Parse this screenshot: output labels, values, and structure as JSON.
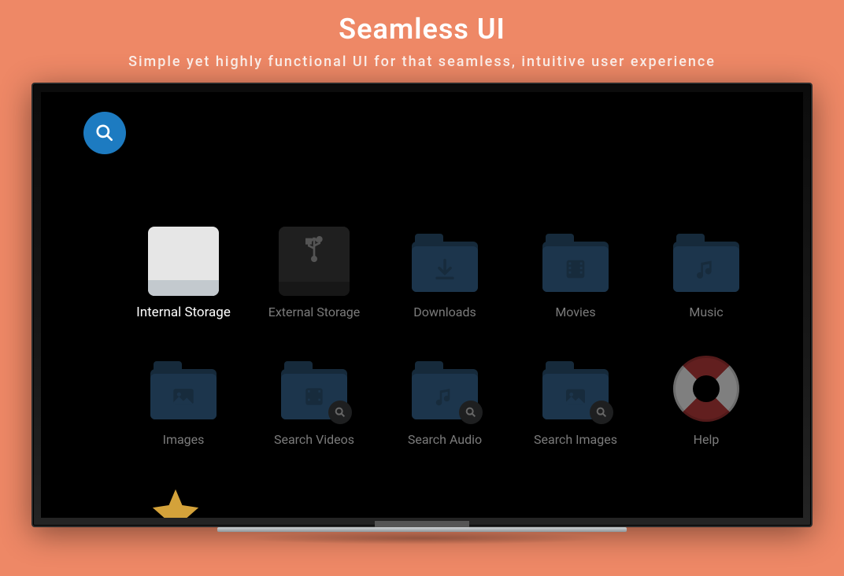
{
  "hero": {
    "title": "Seamless UI",
    "subtitle": "Simple yet highly functional UI for that seamless, intuitive user experience"
  },
  "screen": {
    "search_button": "Search",
    "tiles": [
      {
        "label": "Internal Storage",
        "icon": "drive-icon",
        "active": true
      },
      {
        "label": "External Storage",
        "icon": "usb-drive-icon",
        "active": false
      },
      {
        "label": "Downloads",
        "icon": "download-folder-icon",
        "active": false
      },
      {
        "label": "Movies",
        "icon": "movies-folder-icon",
        "active": false
      },
      {
        "label": "Music",
        "icon": "music-folder-icon",
        "active": false
      },
      {
        "label": "Images",
        "icon": "images-folder-icon",
        "active": false
      },
      {
        "label": "Search Videos",
        "icon": "search-videos-folder-icon",
        "active": false
      },
      {
        "label": "Search Audio",
        "icon": "search-audio-folder-icon",
        "active": false
      },
      {
        "label": "Search Images",
        "icon": "search-images-folder-icon",
        "active": false
      },
      {
        "label": "Help",
        "icon": "lifebuoy-icon",
        "active": false
      }
    ]
  },
  "colors": {
    "page_bg": "#ee8866",
    "accent": "#1d7bc1",
    "folder_dark": "#294e6c",
    "folder_light": "#34618a"
  }
}
